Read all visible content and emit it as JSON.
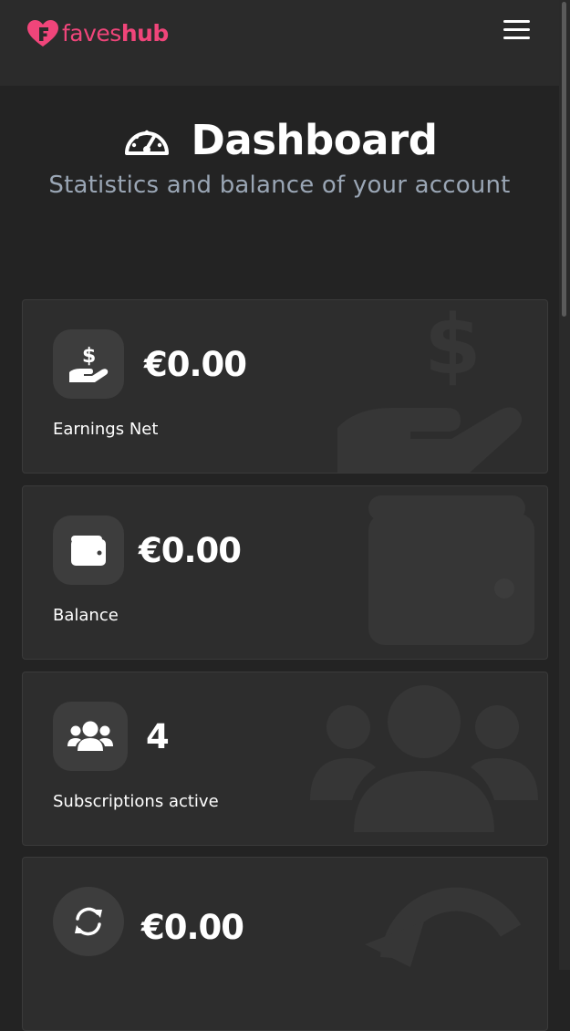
{
  "brand": {
    "name_light": "faves",
    "name_bold": "hub",
    "color": "#f0457a"
  },
  "header": {
    "menu_icon": "hamburger-menu-icon"
  },
  "page": {
    "icon": "gauge-icon",
    "title": "Dashboard",
    "subtitle": "Statistics and balance of your account"
  },
  "cards": [
    {
      "icon": "hand-holding-dollar-icon",
      "value": "€0.00",
      "label": "Earnings Net"
    },
    {
      "icon": "wallet-icon",
      "value": "€0.00",
      "label": "Balance"
    },
    {
      "icon": "users-icon",
      "value": "4",
      "label": "Subscriptions active"
    },
    {
      "icon": "sync-icon",
      "value": "€0.00",
      "label": ""
    }
  ],
  "colors": {
    "background": "#232323",
    "topbar": "#2b2b2b",
    "card": "#2d2d2d",
    "icon_box": "#3d3d3d",
    "subtitle": "#9aa6b5"
  }
}
